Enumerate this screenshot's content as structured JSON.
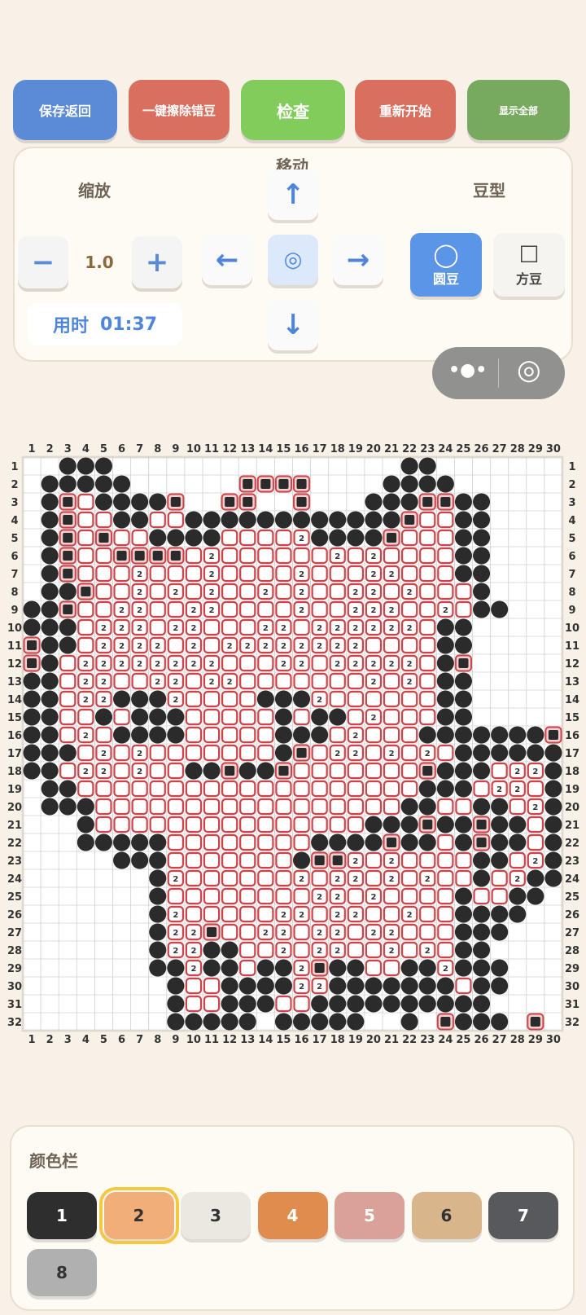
{
  "toolbar": {
    "save_back": "保存返回",
    "erase_wrong": "一键擦除错豆",
    "check": "检查",
    "restart": "重新开始",
    "show_all": "显示全部"
  },
  "controls": {
    "zoom_label": "缩放",
    "move_label": "移动",
    "bean_type_label": "豆型",
    "zoom_value": "1.0",
    "minus": "−",
    "plus": "+",
    "up": "↑",
    "down": "↓",
    "left": "←",
    "right": "→",
    "center": "◎",
    "round_bean_icon": "◯",
    "round_bean": "圆豆",
    "square_bean_icon": "☐",
    "square_bean": "方豆",
    "timer_label": "用时",
    "timer_value": "01:37"
  },
  "capsule": {
    "more_icon": "•●•",
    "target_icon": "◎"
  },
  "grid": {
    "cols": 30,
    "rows": 32,
    "col_labels": [
      "1",
      "2",
      "3",
      "4",
      "5",
      "6",
      "7",
      "8",
      "9",
      "10",
      "11",
      "12",
      "13",
      "14",
      "15",
      "16",
      "17",
      "18",
      "19",
      "20",
      "21",
      "22",
      "23",
      "24",
      "25",
      "26",
      "27",
      "28",
      "29",
      "30"
    ],
    "row_labels": [
      "1",
      "2",
      "3",
      "4",
      "5",
      "6",
      "7",
      "8",
      "9",
      "10",
      "11",
      "12",
      "13",
      "14",
      "15",
      "16",
      "17",
      "18",
      "19",
      "20",
      "21",
      "22",
      "23",
      "24",
      "25",
      "26",
      "27",
      "28",
      "29",
      "30",
      "31",
      "32"
    ],
    "cell_text": "2",
    "colors": {
      "black": "#2b2b2b",
      "red": "#c9454b",
      "pink": "#f3cfd0",
      "grid_line": "#d0d0d0"
    },
    "legend": "b = black bean, R = placed bean marked wrong, 2 = bean labeled 2, r = open cell of color 2, . = empty",
    "pattern": [
      "..bbb................bb.......",
      ".bbbbb......RRRR....bbbb......",
      ".bRrbbbbR..RR..R...bbbRRbb....",
      ".bRrrbbrrbbbbbbbbbbbbRrrbb....",
      ".bRrRrrbbbbrrrr2bbbbRrrrbb....",
      ".bRrrRRRRr2rrrrrr2r2rrrrbb....",
      ".bRrrr2rrr2rrrr2rrr22rrrbb....",
      ".bbRrr2r2r2rr2r2rr22r2rrrb....",
      "bbRrr22rr22rrrr2rr222rr2rbb...",
      "bbbr222r22rrr22r222222rbb.....",
      "Rbbr2222r2r22222222rrrrbb.....",
      "Rbr22222222rrr22r22222rbR.....",
      "bbr22rr22r22rrrrrrr2r2rbb.....",
      "bbr22bbb2rrrrbbb2rrrrrrbb.....",
      "bbrrbrbbbrrrrrbrbbr2rrrbb.....",
      "bbr2rbbbbrrrrrbbbr2rrrbbbbbbbR",
      "bbbr2r2rrrrrrrbRr22r2r2rbbbbbb",
      "bbr22r2rrbbRbbRrrrrrrrRbbbr22b",
      ".bbrrrrrrrrrrrrrrrrrrrbbbr22rb",
      ".bbbrrrrrrrrrrrrrrrrrbbrrbbr2b",
      "...brrrrrrrrrrrrrrrbbbRbbRbbrb",
      "...bbbbbrrrrrrrrbbbbRbbrbRbbrb",
      ".....bbbrrrrrrrbRR2r2rrrrbbr2b",
      ".......b2rrrrrr2r22r2r2rrbr2bb",
      ".......brrrrrrrr22r2rrrrbrrbb.",
      ".......b2rrrrr22r22rr2rrbbbb..",
      ".......b22Rrr22r22r22rrrbbb...",
      ".......b22bbrr2r22rr2r2rbb....",
      ".......bb2bbrbb2Rbbrrbb2bbb...",
      "........brrbbbb22bbbbbbbrbb...",
      "........brrbbbrrbbbbbbbbbb....",
      "........bbbbb.bbbbb..b.Rbbb.R."
    ]
  },
  "palette": {
    "title": "颜色栏",
    "items": [
      {
        "label": "1",
        "color": "#2e2e2e",
        "text_color": "#ffffff",
        "selected": false
      },
      {
        "label": "2",
        "color": "#f2ae78",
        "text_color": "#333333",
        "selected": true
      },
      {
        "label": "3",
        "color": "#ebe8e2",
        "text_color": "#333333",
        "selected": false
      },
      {
        "label": "4",
        "color": "#e08c4e",
        "text_color": "#ffffff",
        "selected": false
      },
      {
        "label": "5",
        "color": "#d9a197",
        "text_color": "#ffffff",
        "selected": false
      },
      {
        "label": "6",
        "color": "#d8b58a",
        "text_color": "#333333",
        "selected": false
      },
      {
        "label": "7",
        "color": "#58595c",
        "text_color": "#ffffff",
        "selected": false
      },
      {
        "label": "8",
        "color": "#b0b0b0",
        "text_color": "#333333",
        "selected": false
      }
    ],
    "selected_border": "#f5c842"
  }
}
